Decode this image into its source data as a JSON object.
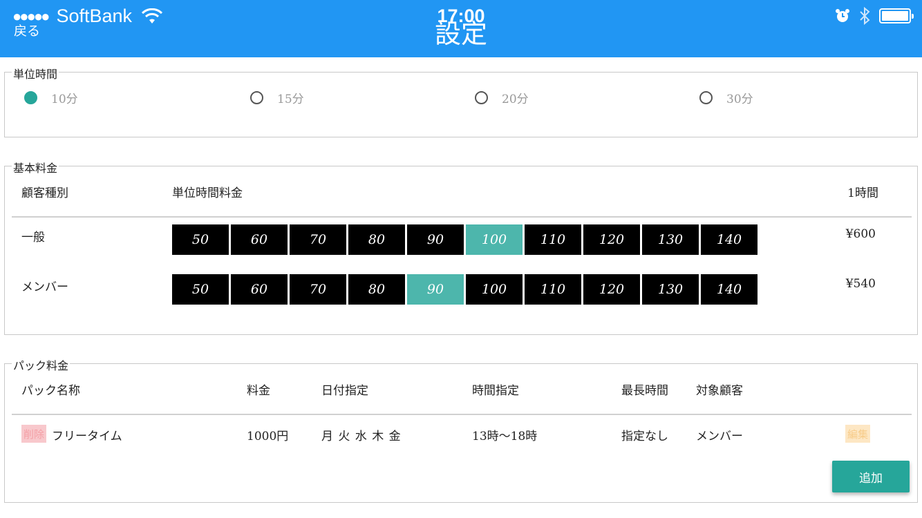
{
  "status_bar": {
    "carrier": "SoftBank",
    "time": "17:00"
  },
  "header": {
    "back_label": "戻る",
    "title": "設定",
    "color": "#2196f3"
  },
  "unit_time": {
    "legend": "単位時間",
    "options": [
      {
        "label": "10分",
        "selected": true
      },
      {
        "label": "15分",
        "selected": false
      },
      {
        "label": "20分",
        "selected": false
      },
      {
        "label": "30分",
        "selected": false
      }
    ]
  },
  "base_fee": {
    "legend": "基本料金",
    "headers": {
      "customer_type": "顧客種別",
      "unit_fee": "単位時間料金",
      "per_hour": "1時間"
    },
    "rows": [
      {
        "label": "一般",
        "values": [
          "50",
          "60",
          "70",
          "80",
          "90",
          "100",
          "110",
          "120",
          "130",
          "140"
        ],
        "selected": "100",
        "hourly": "¥600"
      },
      {
        "label": "メンバー",
        "values": [
          "50",
          "60",
          "70",
          "80",
          "90",
          "100",
          "110",
          "120",
          "130",
          "140"
        ],
        "selected": "90",
        "hourly": "¥540"
      }
    ],
    "selected_color": "#4db6ac"
  },
  "pack_fee": {
    "legend": "パック料金",
    "headers": {
      "name": "パック名称",
      "price": "料金",
      "date": "日付指定",
      "time": "時間指定",
      "max": "最長時間",
      "target": "対象顧客"
    },
    "rows": [
      {
        "delete_label": "削除",
        "name": "フリータイム",
        "price": "1000円",
        "date": "月 火 水 木 金",
        "time": "13時〜18時",
        "max": "指定なし",
        "target": "メンバー",
        "edit_label": "編集"
      }
    ],
    "add_label": "追加",
    "accent": "#26a69a"
  }
}
